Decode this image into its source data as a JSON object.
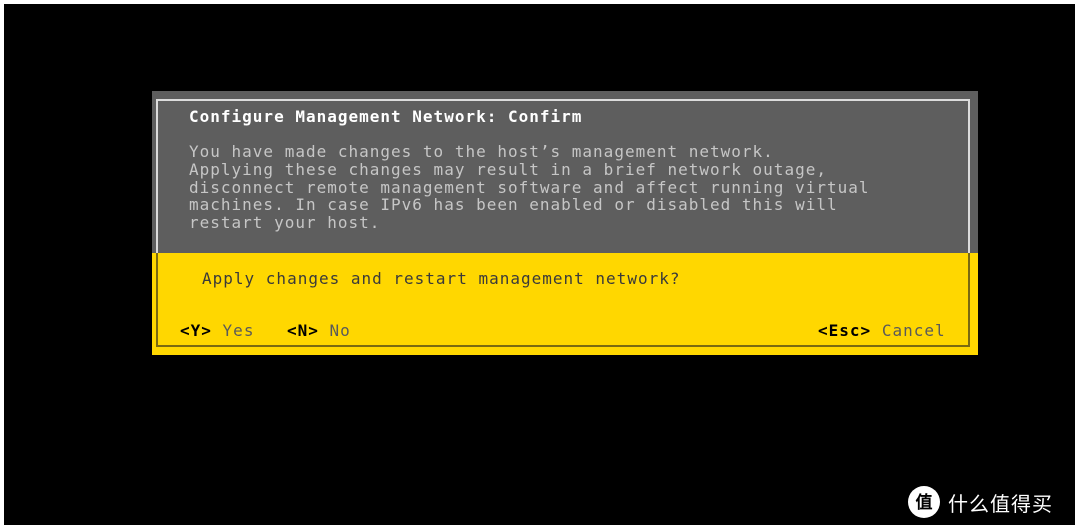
{
  "dialog": {
    "title": "Configure Management Network: Confirm",
    "message_lines": [
      "You have made changes to the host’s management network.",
      "Applying these changes may result in a brief network outage,",
      "disconnect remote management software and affect running virtual",
      "machines. In case IPv6 has been enabled or disabled this will",
      "restart your host."
    ],
    "question": "Apply changes and restart management network?",
    "actions": {
      "yes_key": "<Y>",
      "yes_label": "Yes",
      "no_key": "<N>",
      "no_label": "No",
      "cancel_key": "<Esc>",
      "cancel_label": "Cancel"
    }
  },
  "watermark": {
    "logo_char": "值",
    "text": "什么值得买"
  },
  "colors": {
    "background": "#000000",
    "dialog_top": "#5e5e5e",
    "dialog_bottom": "#ffd700"
  }
}
